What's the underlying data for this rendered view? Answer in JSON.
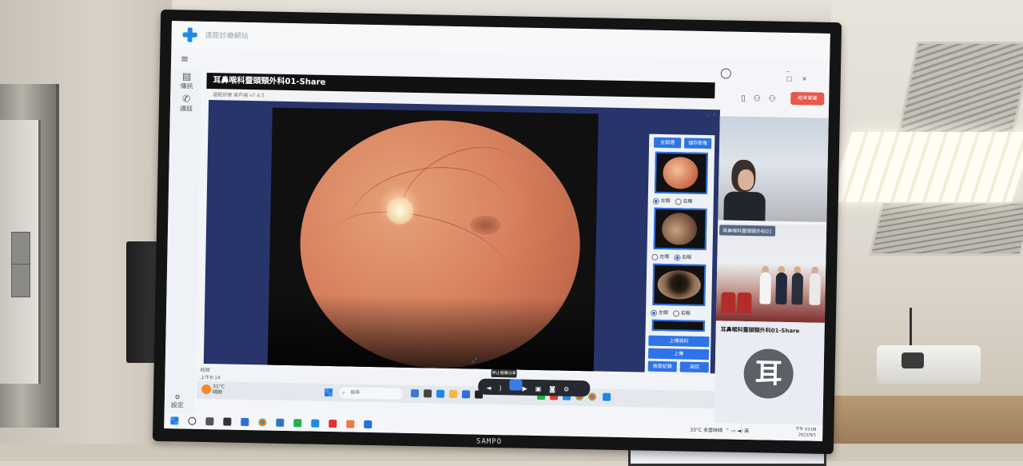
{
  "app": {
    "title": "遠距診療網站",
    "share_title": "耳鼻喉科暨頭頸外科01-Share",
    "share_subtitle": "遠距診療 客戶端 v7.4.5"
  },
  "sidebar": {
    "items": [
      {
        "label": "傳訊"
      },
      {
        "label": "通話"
      }
    ],
    "settings_label": "設定"
  },
  "header": {
    "end_call_label": "結束會議"
  },
  "thumbs_panel": {
    "top_buttons": [
      "全部選",
      "儲存影像"
    ],
    "radio_a": "左眼",
    "radio_b": "右眼",
    "action_buttons": [
      "上傳資料",
      "上傳",
      "檢查紀錄",
      "返回"
    ]
  },
  "inner_status": {
    "line1": "時間",
    "line2": "上午8:14"
  },
  "inner_taskbar": {
    "weather_temp": "31°C",
    "weather_desc": "晴朗",
    "search_placeholder": "搜尋",
    "tooltip": "停止螢幕分享"
  },
  "video": {
    "tile2_label": "耳鼻喉科暨頭頸外科01",
    "tile3_label": "耳鼻喉科暨頭頸外科01-Share",
    "avatar_char": "耳"
  },
  "main_taskbar": {
    "weather": "33°C 多雲時晴",
    "tray_lang": "英",
    "clock_time": "下午 03:08",
    "clock_date": "2022/9/1"
  },
  "monitor": {
    "brand": "SAMPO"
  },
  "colors": {
    "accent_blue": "#2f74e6",
    "end_call_red": "#e55a4a",
    "viewer_bg": "#28356b"
  }
}
